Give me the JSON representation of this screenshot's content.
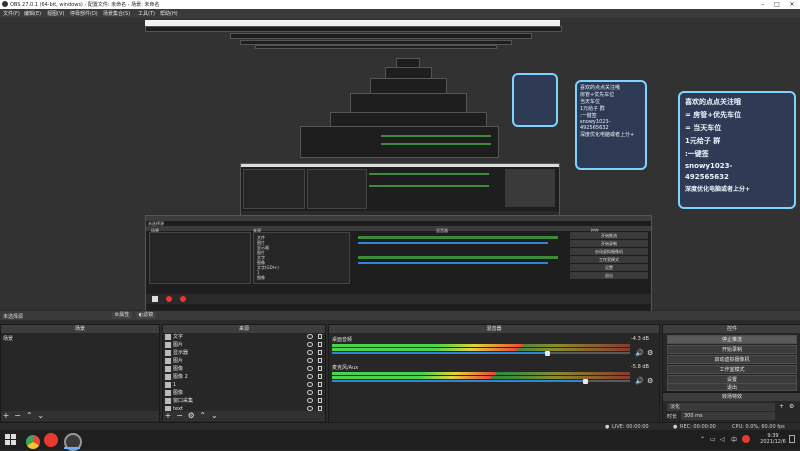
{
  "window": {
    "title": "OBS 27.0.1 (64-bit, windows) - 配置文件: 未命名 - 场景: 未命名"
  },
  "menu": [
    "文件(F)",
    "编辑(E)",
    "视图(V)",
    "停靠部件(D)",
    "场景集合(S)",
    "工具(T)",
    "帮助(H)"
  ],
  "overlay_small": {
    "lines": [
      "喜欢的点点关注哦",
      "房管+优先车位",
      "当天车位",
      "1元给子 群",
      ":一键签",
      "snowy1023-",
      "492565632",
      "深度优化电脑或者上分+"
    ]
  },
  "overlay_big": {
    "lines": [
      "喜欢的点点关注哦",
      "= 房管+优先车位",
      "= 当天车位",
      "1元给子 群",
      ":一键签",
      "snowy1023-",
      "492565632",
      "深度优化电脑或者上分+"
    ]
  },
  "nested_preview": {
    "scene_label": "场景",
    "sources_label": "来源",
    "mixer_label": "混音器",
    "controls_label": "控件",
    "source_items": [
      "文件",
      "图片",
      "显示器",
      "图片",
      "文字",
      "图像",
      "文字(GDI+)",
      "1",
      "图像",
      "窗口采集"
    ],
    "control_items": [
      "开始推流",
      "开始录制",
      "启动虚拟摄像机",
      "工作室模式",
      "设置",
      "退出"
    ]
  },
  "scene_tabs": {
    "label": "未选择源",
    "properties": "属性",
    "filters": "滤镜"
  },
  "docks": {
    "scenes": {
      "title": "场景",
      "items": [
        "场景"
      ]
    },
    "sources": {
      "title": "来源",
      "items": [
        "文字",
        "图片",
        "显示器",
        "图片",
        "图像",
        "图像 2",
        "1",
        "图像",
        "窗口采集",
        "text"
      ]
    },
    "mixer": {
      "title": "混音器",
      "channels": [
        {
          "name": "桌面音频",
          "db": "-4.3 dB",
          "level": 0.64,
          "volume": 0.72
        },
        {
          "name": "麦克风/Aux",
          "db": "-5.8 dB",
          "level": 0.55,
          "volume": 0.85
        }
      ],
      "tick_labels": [
        "-60",
        "-55",
        "-50",
        "-45",
        "-40",
        "-35",
        "-30",
        "-25",
        "-20",
        "-15",
        "-10",
        "-5",
        "0"
      ]
    },
    "transitions": {
      "title": "转场特效",
      "type": "淡化",
      "duration_label": "时长",
      "duration_value": "300 ms"
    },
    "controls": {
      "title": "控件",
      "buttons": [
        "停止推流",
        "开始录制",
        "启动虚拟摄像机",
        "工作室模式",
        "设置",
        "退出"
      ],
      "active_index": 0
    }
  },
  "statusbar": {
    "live": "LIVE: 00:00:00",
    "rec": "REC: 00:00:00",
    "cpu": "CPU: 0.0%, 60.00 fps"
  },
  "taskbar": {
    "time": "9:39",
    "date": "2021/12/6",
    "lang": "中"
  },
  "colors": {
    "accent": "#2f86d9",
    "overlay_border": "#7fd3ff",
    "meter_green": "#4cd24c",
    "meter_yellow": "#e6d23a",
    "meter_red": "#e64a3a"
  }
}
